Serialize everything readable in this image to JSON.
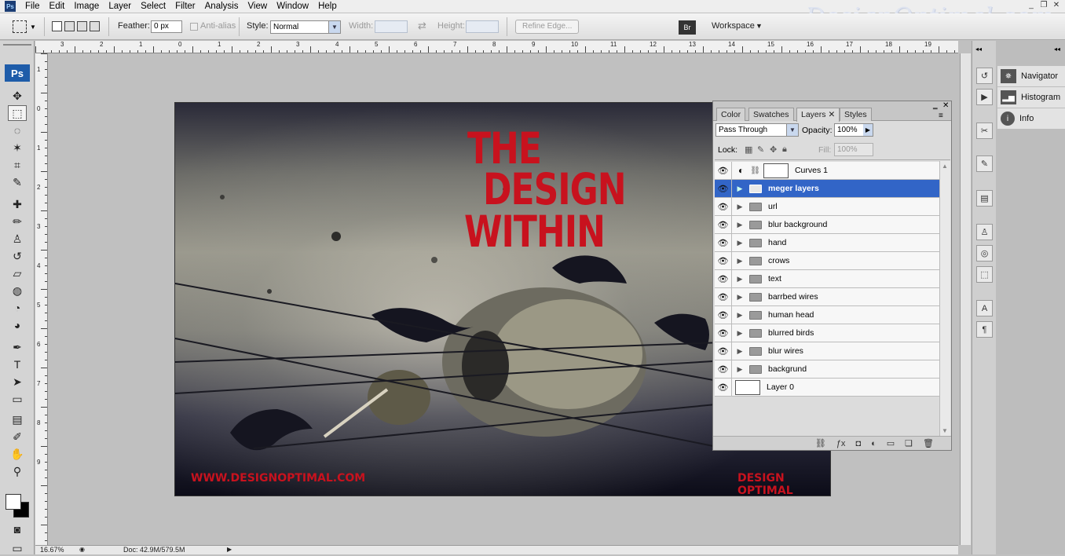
{
  "app": {
    "logo": "Ps",
    "menu": [
      "File",
      "Edit",
      "Image",
      "Layer",
      "Select",
      "Filter",
      "Analysis",
      "View",
      "Window",
      "Help"
    ],
    "brand_watermark": "DesignOptimal.com",
    "window_controls": [
      "_",
      "❐",
      "✕"
    ]
  },
  "options_bar": {
    "feather_label": "Feather:",
    "feather_value": "0 px",
    "antialias_label": "Anti-alias",
    "style_label": "Style:",
    "style_value": "Normal",
    "width_label": "Width:",
    "height_label": "Height:",
    "refine_edge_label": "Refine Edge...",
    "workspace_label": "Workspace"
  },
  "toolbar": {
    "logo": "Ps",
    "tools": [
      {
        "name": "move-tool-icon",
        "glyph": "✥"
      },
      {
        "name": "marquee-tool-icon",
        "glyph": "⬚"
      },
      {
        "name": "lasso-tool-icon",
        "glyph": "◌"
      },
      {
        "name": "magic-wand-tool-icon",
        "glyph": "✶"
      },
      {
        "name": "crop-tool-icon",
        "glyph": "⌗"
      },
      {
        "name": "eyedropper-tool-icon",
        "glyph": "✎"
      },
      {
        "name": "healing-brush-tool-icon",
        "glyph": "✚"
      },
      {
        "name": "brush-tool-icon",
        "glyph": "✏"
      },
      {
        "name": "clone-stamp-tool-icon",
        "glyph": "♙"
      },
      {
        "name": "history-brush-tool-icon",
        "glyph": "↺"
      },
      {
        "name": "eraser-tool-icon",
        "glyph": "▱"
      },
      {
        "name": "paint-bucket-tool-icon",
        "glyph": "◍"
      },
      {
        "name": "blur-tool-icon",
        "glyph": "◔"
      },
      {
        "name": "dodge-tool-icon",
        "glyph": "◕"
      },
      {
        "name": "pen-tool-icon",
        "glyph": "✒"
      },
      {
        "name": "type-tool-icon",
        "glyph": "T"
      },
      {
        "name": "path-selection-tool-icon",
        "glyph": "➤"
      },
      {
        "name": "shape-tool-icon",
        "glyph": "▭"
      },
      {
        "name": "notes-tool-icon",
        "glyph": "▤"
      },
      {
        "name": "eyedropper2-tool-icon",
        "glyph": "✐"
      },
      {
        "name": "hand-tool-icon",
        "glyph": "✋"
      },
      {
        "name": "zoom-tool-icon",
        "glyph": "⚲"
      }
    ]
  },
  "ruler": {
    "top_labels": [
      "3",
      "2",
      "1",
      "0",
      "1",
      "2",
      "3",
      "4",
      "5",
      "6",
      "7",
      "8",
      "9",
      "10",
      "11",
      "12",
      "13",
      "14",
      "15",
      "16",
      "17",
      "18",
      "19"
    ],
    "left_labels": [
      "1",
      "0",
      "1",
      "2",
      "3",
      "4",
      "5",
      "6",
      "7",
      "8",
      "9"
    ]
  },
  "artwork": {
    "title_lines": [
      "THE",
      "DESIGN",
      "WITHIN"
    ],
    "footer_left": "WWW.DESIGNOPTIMAL.COM",
    "footer_right": "DESIGN OPTIMAL"
  },
  "layers_panel": {
    "tabs": [
      "Color",
      "Swatches",
      "Layers",
      "Styles"
    ],
    "blend_mode": "Pass Through",
    "opacity_label": "Opacity:",
    "opacity_value": "100%",
    "lock_label": "Lock:",
    "fill_label": "Fill:",
    "fill_value": "100%",
    "layers": [
      {
        "name": "Curves 1",
        "type": "adjustment"
      },
      {
        "name": "meger layers",
        "type": "group",
        "selected": true
      },
      {
        "name": "url",
        "type": "group"
      },
      {
        "name": "blur background",
        "type": "group"
      },
      {
        "name": "hand",
        "type": "group"
      },
      {
        "name": "crows",
        "type": "group"
      },
      {
        "name": "text",
        "type": "group"
      },
      {
        "name": "barrbed wires",
        "type": "group"
      },
      {
        "name": "human head",
        "type": "group"
      },
      {
        "name": "blurred birds",
        "type": "group"
      },
      {
        "name": "blur wires",
        "type": "group"
      },
      {
        "name": "backgrund",
        "type": "group"
      },
      {
        "name": "Layer 0",
        "type": "layer"
      }
    ],
    "footer_icons": [
      "link-layers-icon",
      "fx-icon",
      "mask-icon",
      "adjustment-icon",
      "new-group-icon",
      "new-layer-icon",
      "trash-icon"
    ]
  },
  "dock": {
    "items": [
      "Navigator",
      "Histogram",
      "Info"
    ]
  },
  "statusbar": {
    "zoom": "16.67%",
    "doc": "Doc: 42.9M/579.5M"
  },
  "colors": {
    "accent_selected": "#3265c7",
    "title_red": "#c8121e"
  }
}
